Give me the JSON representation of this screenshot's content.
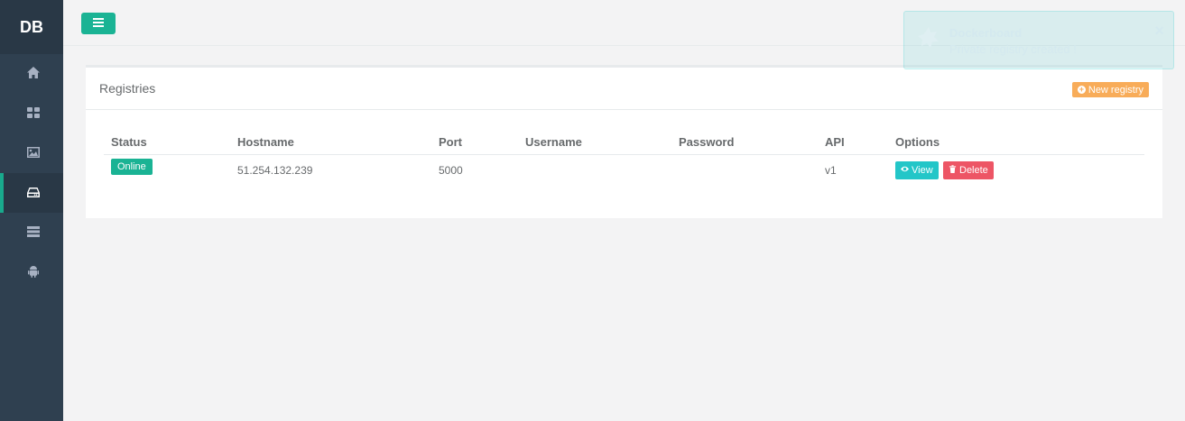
{
  "brand": "DB",
  "sidebar": {
    "items": [
      {
        "icon": "home-icon",
        "active": false
      },
      {
        "icon": "dashboard-icon",
        "active": false
      },
      {
        "icon": "image-icon",
        "active": false
      },
      {
        "icon": "hdd-icon",
        "active": true
      },
      {
        "icon": "server-icon",
        "active": false
      },
      {
        "icon": "android-icon",
        "active": false
      }
    ]
  },
  "panel": {
    "title": "Registries",
    "new_button": "New registry"
  },
  "table": {
    "headers": [
      "Status",
      "Hostname",
      "Port",
      "Username",
      "Password",
      "API",
      "Options"
    ],
    "rows": [
      {
        "status": "Online",
        "hostname": "51.254.132.239",
        "port": "5000",
        "username": "",
        "password": "",
        "api": "v1",
        "view_label": "View",
        "delete_label": "Delete"
      }
    ]
  },
  "toast": {
    "title": "Dockerboard",
    "message": "Private registry created !",
    "close": "×"
  },
  "colors": {
    "accent": "#1ab394",
    "warning": "#f8ac59",
    "info": "#23c6c8",
    "danger": "#ed5565",
    "sidebar": "#2f4050"
  }
}
